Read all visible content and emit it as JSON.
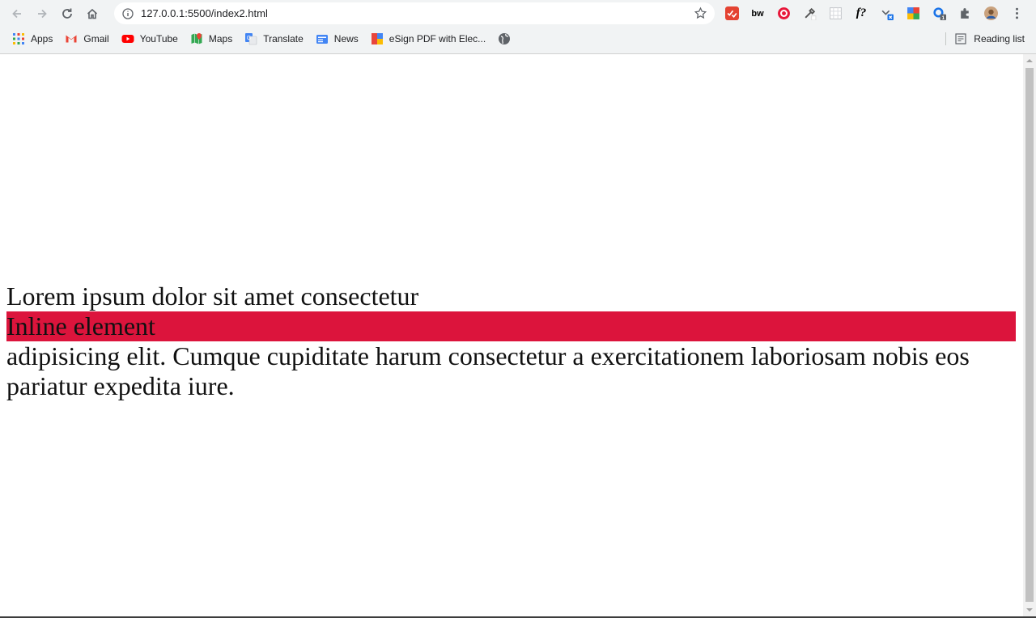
{
  "browser": {
    "url": "127.0.0.1:5500/index2.html",
    "extensions": [
      {
        "name": "todoist-extension",
        "label": "",
        "color": "#e44332"
      },
      {
        "name": "bw-extension",
        "label": "bw",
        "color": "#000000"
      },
      {
        "name": "target-extension",
        "label": "",
        "color": "#e8173a"
      },
      {
        "name": "eyedropper-extension",
        "label": "",
        "color": "#555555"
      },
      {
        "name": "grid-extension",
        "label": "",
        "color": "#9aa0a6"
      },
      {
        "name": "whatfont-extension",
        "label": "f?",
        "color": "#202124"
      },
      {
        "name": "download-extension",
        "label": "",
        "color": "#1a73e8"
      },
      {
        "name": "colorful-extension",
        "label": "",
        "color": "#4285f4"
      },
      {
        "name": "gear-extension",
        "label": "",
        "color": "#1a73e8"
      },
      {
        "name": "puzzle-extension",
        "label": "",
        "color": "#5f6368"
      }
    ],
    "bookmarks": [
      {
        "name": "apps",
        "label": "Apps",
        "icon": "apps-grid-icon"
      },
      {
        "name": "gmail",
        "label": "Gmail",
        "icon": "gmail-icon"
      },
      {
        "name": "youtube",
        "label": "YouTube",
        "icon": "youtube-icon"
      },
      {
        "name": "maps",
        "label": "Maps",
        "icon": "maps-icon"
      },
      {
        "name": "translate",
        "label": "Translate",
        "icon": "translate-icon"
      },
      {
        "name": "news",
        "label": "News",
        "icon": "news-icon"
      },
      {
        "name": "esign",
        "label": "eSign PDF with Elec...",
        "icon": "esign-icon"
      },
      {
        "name": "globe",
        "label": "",
        "icon": "globe-icon"
      }
    ],
    "reading_list_label": "Reading list"
  },
  "page": {
    "line1": "Lorem ipsum dolor sit amet consectetur",
    "inline_element": "Inline element",
    "line3": "adipisicing elit. Cumque cupiditate harum consectetur a exercitationem laboriosam nobis eos pariatur expedita iure.",
    "highlight_color": "#dc143c"
  }
}
